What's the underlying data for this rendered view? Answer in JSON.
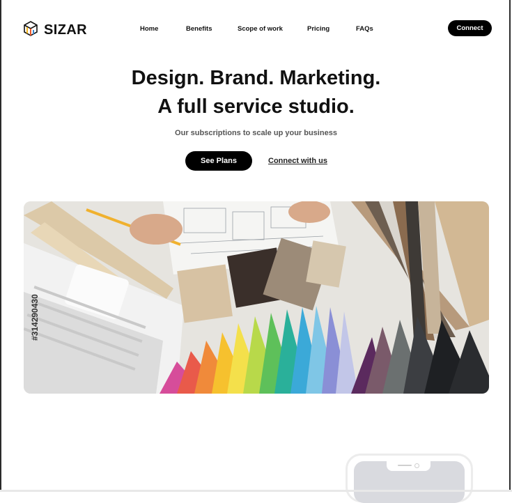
{
  "brand": {
    "name": "SIZAR",
    "logo_icon": "cube-logo-icon"
  },
  "nav": {
    "items": [
      {
        "label": "Home"
      },
      {
        "label": "Benefits"
      },
      {
        "label": "Scope of work"
      },
      {
        "label": "Pricing"
      },
      {
        "label": "FAQs"
      }
    ],
    "connect_label": "Connect"
  },
  "hero": {
    "title_line1": "Design. Brand. Marketing.",
    "title_line2": "A full service studio.",
    "subtitle": "Our subscriptions to scale up your business",
    "primary_cta": "See Plans",
    "secondary_cta": "Connect with us"
  },
  "hero_image": {
    "description_icon": "design-materials-photo",
    "stock_id": "#314290430"
  },
  "colors": {
    "text": "#111111",
    "button_bg": "#000000",
    "button_text": "#ffffff",
    "subtitle": "#555555"
  }
}
